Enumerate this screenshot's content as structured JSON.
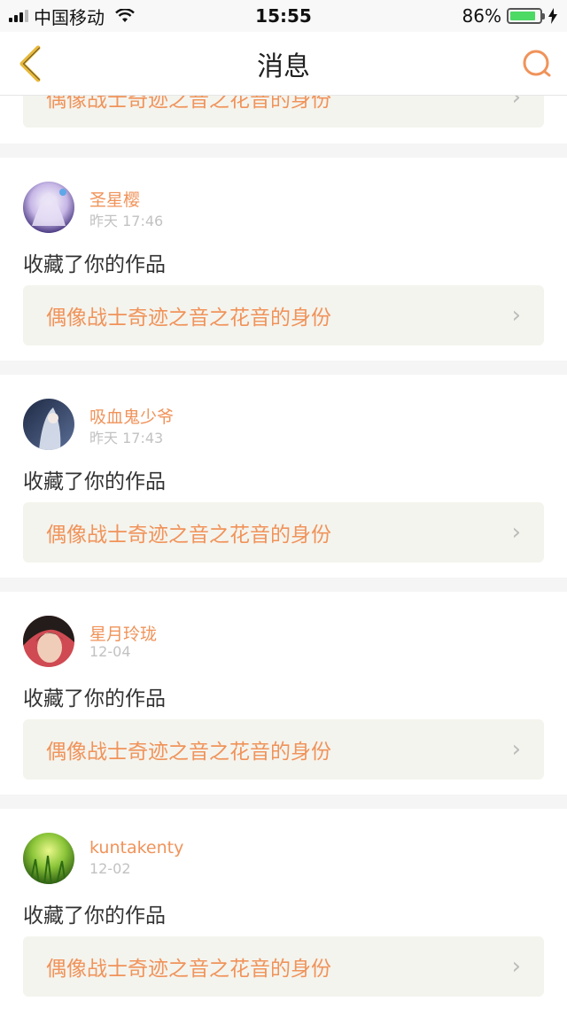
{
  "status_bar": {
    "carrier": "中国移动",
    "time": "15:55",
    "battery": "86%",
    "battery_level": 0.86
  },
  "nav": {
    "title": "消息",
    "back_icon": "chevron-left-icon",
    "search_icon": "search-icon"
  },
  "partial_item": {
    "link_text": "偶像战士奇迹之音之花音的身份"
  },
  "items": [
    {
      "username": "圣星樱",
      "time": "昨天 17:46",
      "action": "收藏了你的作品",
      "link_text": "偶像战士奇迹之音之花音的身份",
      "avatar_colors": [
        "#e9e2f5",
        "#7a6aa8"
      ]
    },
    {
      "username": "吸血鬼少爷",
      "time": "昨天 17:43",
      "action": "收藏了你的作品",
      "link_text": "偶像战士奇迹之音之花音的身份",
      "avatar_colors": [
        "#3b4a6b",
        "#c9d3e6"
      ]
    },
    {
      "username": "星月玲珑",
      "time": "12-04",
      "action": "收藏了你的作品",
      "link_text": "偶像战士奇迹之音之花音的身份",
      "avatar_colors": [
        "#2a2220",
        "#d9b3a6"
      ]
    },
    {
      "username": "kuntakenty",
      "time": "12-02",
      "action": "收藏了你的作品",
      "link_text": "偶像战士奇迹之音之花音的身份",
      "avatar_colors": [
        "#4c8a1f",
        "#c7e35a"
      ]
    }
  ],
  "colors": {
    "accent": "#f0935a",
    "link_bg": "#f4f4ee"
  }
}
